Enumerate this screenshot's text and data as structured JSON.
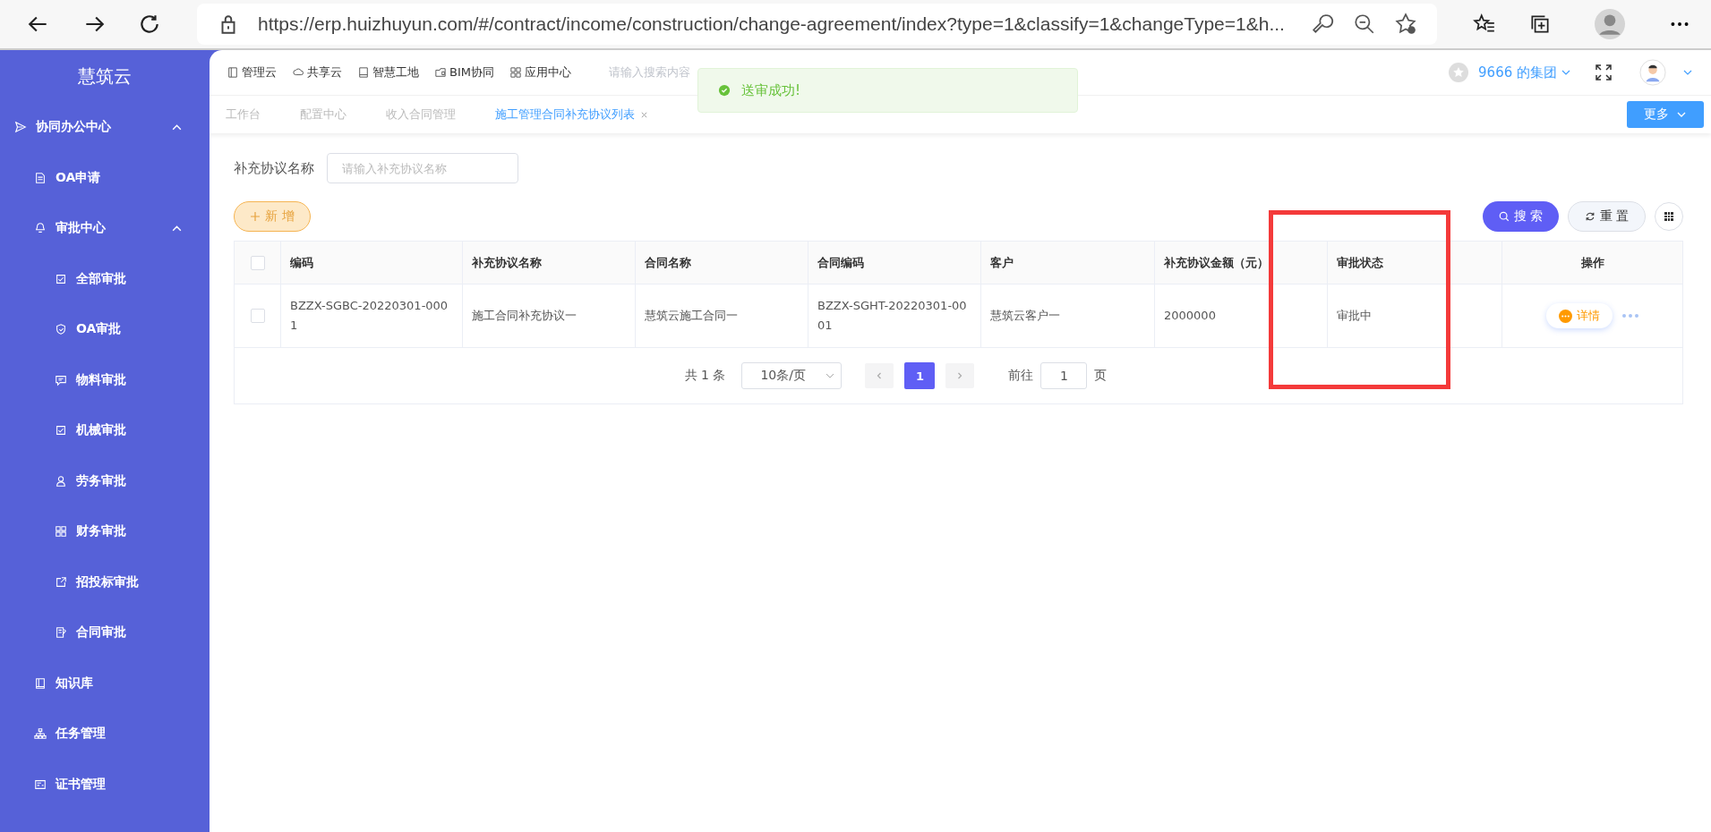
{
  "browser": {
    "url": "https://erp.huizhuyun.com/#/contract/income/construction/change-agreement/index?type=1&classify=1&changeType=1&h..."
  },
  "sidebar": {
    "title": "慧筑云",
    "items": [
      {
        "label": "协同办公中心",
        "expanded": true,
        "children": [
          {
            "label": "OA申请"
          },
          {
            "label": "审批中心",
            "expanded": true,
            "children": [
              {
                "label": "全部审批"
              },
              {
                "label": "OA审批"
              },
              {
                "label": "物料审批"
              },
              {
                "label": "机械审批"
              },
              {
                "label": "劳务审批"
              },
              {
                "label": "财务审批"
              },
              {
                "label": "招投标审批"
              },
              {
                "label": "合同审批"
              }
            ]
          },
          {
            "label": "知识库"
          },
          {
            "label": "任务管理"
          },
          {
            "label": "证书管理"
          }
        ]
      }
    ]
  },
  "header": {
    "nav": [
      "管理云",
      "共享云",
      "智慧工地",
      "BIM协同",
      "应用中心"
    ],
    "search_placeholder": "请输入搜索内容",
    "org": "9666 的集团"
  },
  "toast": {
    "message": "送审成功!"
  },
  "tabs": [
    {
      "label": "工作台",
      "selected": false
    },
    {
      "label": "配置中心",
      "selected": false
    },
    {
      "label": "收入合同管理",
      "selected": false
    },
    {
      "label": "施工管理合同补充协议列表",
      "selected": true
    }
  ],
  "more_button": "更多",
  "filter": {
    "label": "补充协议名称",
    "placeholder": "请输入补充协议名称"
  },
  "add_button": "新 增",
  "search_button": "搜 索",
  "reset_button": "重 置",
  "table": {
    "all_checked": false,
    "columns": [
      "编码",
      "补充协议名称",
      "合同名称",
      "合同编码",
      "客户",
      "补充协议金额（元）",
      "审批状态",
      "操作"
    ],
    "rows": [
      {
        "checked": false,
        "cells": [
          "BZZX-SGBC-20220301-0001",
          "施工合同补充协议一",
          "慧筑云施工合同一",
          "BZZX-SGHT-20220301-0001",
          "慧筑云客户一",
          "2000000",
          "审批中"
        ],
        "action": "详情"
      }
    ]
  },
  "pagination": {
    "total": "共 1 条",
    "page_size": "10条/页",
    "pages": [
      {
        "label": "1",
        "selected": true
      }
    ],
    "goto_label": "前往",
    "goto_value": "1",
    "page_suffix": "页"
  }
}
